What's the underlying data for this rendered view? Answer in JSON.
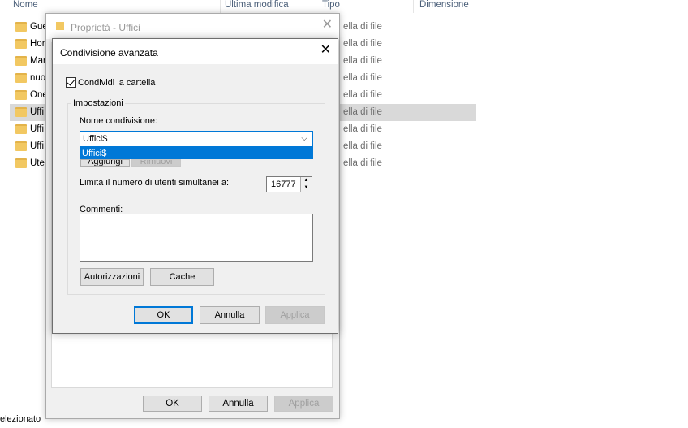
{
  "explorer": {
    "columns": [
      "Nome",
      "Ultima modifica",
      "Tipo",
      "Dimensione"
    ],
    "rows": [
      {
        "name": "Gue",
        "type": "ella di file"
      },
      {
        "name": "Hor",
        "type": "ella di file"
      },
      {
        "name": "Mar",
        "type": "ella di file"
      },
      {
        "name": "nuo",
        "type": "ella di file"
      },
      {
        "name": "One",
        "type": "ella di file"
      },
      {
        "name": "Uffi",
        "type": "ella di file"
      },
      {
        "name": "Uffi",
        "type": "ella di file"
      },
      {
        "name": "Uffi",
        "type": "ella di file"
      },
      {
        "name": "Uter",
        "type": "ella di file"
      }
    ],
    "status": "elezionato"
  },
  "properties_dialog": {
    "title": "Proprietà - Uffici",
    "ok_label": "OK",
    "cancel_label": "Annulla",
    "apply_label": "Applica"
  },
  "advanced_dialog": {
    "title": "Condivisione avanzata",
    "share_checkbox_label": "Condividi la cartella",
    "share_checked": true,
    "settings_group_label": "Impostazioni",
    "share_name_label": "Nome condivisione:",
    "share_name_value": "Uffici$",
    "share_name_option": "Uffici$",
    "add_label": "Aggiungi",
    "remove_label": "Rimuovi",
    "limit_label": "Limita il numero di utenti simultanei a:",
    "limit_value": "16777",
    "comments_label": "Commenti:",
    "permissions_label": "Autorizzazioni",
    "cache_label": "Cache",
    "ok_label": "OK",
    "cancel_label": "Annulla",
    "apply_label": "Applica"
  },
  "colors": {
    "accent": "#0078d7",
    "selection_row": "#d9d9d9",
    "folder": "#f2c862"
  }
}
